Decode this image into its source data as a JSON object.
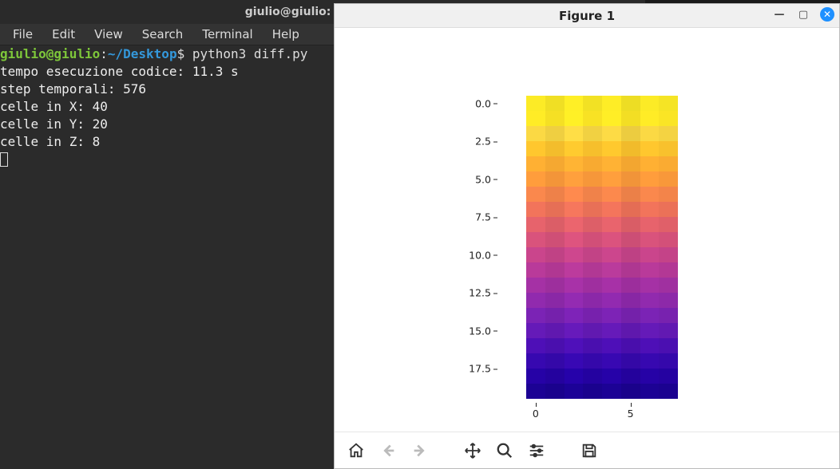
{
  "terminal": {
    "title": "giulio@giulio: ~/Desktop",
    "menu": [
      "File",
      "Edit",
      "View",
      "Search",
      "Terminal",
      "Help"
    ],
    "prompt": {
      "userhost": "giulio@giulio",
      "sep": ":",
      "path": "~/Desktop",
      "sym": "$",
      "command": "python3 diff.py"
    },
    "output": [
      "tempo esecuzione codice: 11.3 s",
      "step temporali: 576",
      "celle in X: 40",
      "celle in Y: 20",
      "celle in Z: 8"
    ]
  },
  "figure": {
    "title": "Figure 1",
    "toolbar": [
      "home",
      "back",
      "forward",
      "pan",
      "zoom",
      "subplots",
      "save"
    ]
  },
  "chart_data": {
    "type": "heatmap",
    "title": "",
    "xlabel": "",
    "ylabel": "",
    "x_ticks": [
      0,
      5
    ],
    "y_ticks": [
      0.0,
      2.5,
      5.0,
      7.5,
      10.0,
      12.5,
      15.0,
      17.5
    ],
    "xlim": [
      -0.5,
      7.5
    ],
    "ylim": [
      19.5,
      -0.5
    ],
    "nx": 8,
    "ny": 20,
    "colormap": "plasma",
    "row_colors": [
      "#f7e625",
      "#fde725",
      "#f6d543",
      "#fbc32d",
      "#fdad32",
      "#fb9a3b",
      "#f5854b",
      "#ed7259",
      "#e2616a",
      "#d5517a",
      "#c64489",
      "#b53997",
      "#a230a2",
      "#8e29ab",
      "#7922b1",
      "#6319b4",
      "#4c0fb3",
      "#3608ad",
      "#2502a3",
      "#1b0291"
    ],
    "column_jitter": [
      0.02,
      -0.03,
      0.04,
      -0.02,
      0.03,
      -0.04,
      0.02,
      -0.01
    ]
  }
}
